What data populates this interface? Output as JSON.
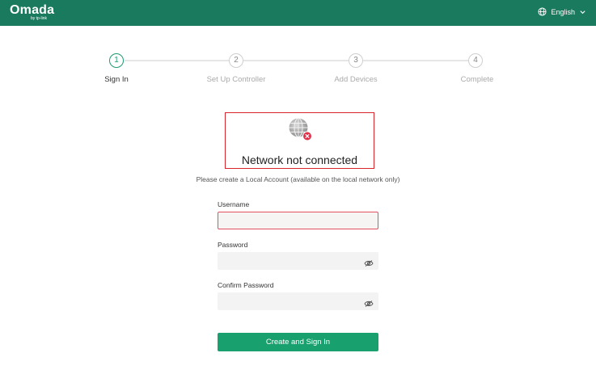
{
  "header": {
    "logo_text": "Omada",
    "logo_subtext": "by tp-link",
    "language_label": "English",
    "globe_icon": "globe-icon",
    "dropdown_icon": "chevron-down-icon",
    "bg_color": "#1a7a5e"
  },
  "steps": [
    {
      "number": "1",
      "label": "Sign In",
      "active": true
    },
    {
      "number": "2",
      "label": "Set Up Controller",
      "active": false
    },
    {
      "number": "3",
      "label": "Add Devices",
      "active": false
    },
    {
      "number": "4",
      "label": "Complete",
      "active": false
    }
  ],
  "alert": {
    "icon": "network-disconnected-icon",
    "text": "Network not connected",
    "border_color": "#d9242b"
  },
  "info_text": "Please create a Local Account (available on the local network only)",
  "form": {
    "username_label": "Username",
    "username_value": "",
    "password_label": "Password",
    "password_value": "",
    "confirm_label": "Confirm Password",
    "confirm_value": "",
    "eye_icon": "eye-icon",
    "submit_label": "Create and Sign In",
    "accent_color": "#18a06e",
    "error_color": "#e05260"
  }
}
